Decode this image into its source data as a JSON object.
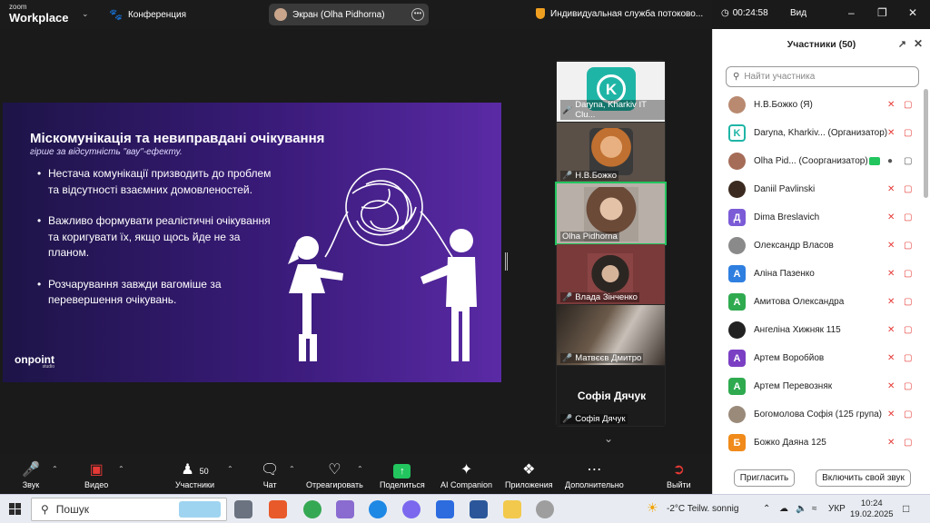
{
  "topbar": {
    "logo_small": "zoom",
    "logo_big": "Workplace",
    "conference_label": "Конференция",
    "screen_share_label": "Экран (Olha Pidhorna)",
    "recording_label": "Индивидуальная служба потоково...",
    "timer": "00:24:58",
    "view_label": "Вид"
  },
  "slide": {
    "title": "Міскомунікація та невиправдані очікування",
    "subtitle": "гірше за відсутність \"вау\"-ефекту.",
    "bullets": [
      "Нестача комунікації призводить до проблем та відсутності взаємних домовленостей.",
      "Важливо формувати реалістичні очікування та коригувати їх, якщо щось йде не за планом.",
      "Розчарування завжди вагоміше за перевершення очікувань."
    ],
    "brand": "onpoint",
    "brand_sub": "studio"
  },
  "tiles": [
    {
      "name": "Daryna, Kharkiv IT Clu...",
      "type": "logo",
      "active": false
    },
    {
      "name": "Н.В.Божко",
      "type": "video",
      "active": false
    },
    {
      "name": "Olha Pidhorna",
      "type": "video",
      "active": true
    },
    {
      "name": "Влада Зінченко",
      "type": "video",
      "active": false
    },
    {
      "name": "Матвєєв Дмитро",
      "type": "video",
      "active": false
    },
    {
      "name": "Софія Дячук",
      "type": "name-only",
      "active": false
    }
  ],
  "tile_big_name": "Софія Дячук",
  "panel": {
    "title": "Участники (50)",
    "search_placeholder": "Найти участника",
    "participants": [
      {
        "name": "Н.В.Божко (Я)",
        "avatar": "photo",
        "color": "#b98a70",
        "initial": ""
      },
      {
        "name": "Daryna, Kharkiv...  (Организатор)",
        "avatar": "logo",
        "color": "#1fb5a6",
        "initial": ""
      },
      {
        "name": "Olha Pid...   (Соорганизатор)",
        "avatar": "photo",
        "color": "#a56c58",
        "initial": ""
      },
      {
        "name": "Daniil Pavlinski",
        "avatar": "photo",
        "color": "#3b2a1f",
        "initial": ""
      },
      {
        "name": "Dima Breslavich",
        "avatar": "letter",
        "color": "#7b5bd6",
        "initial": "Д"
      },
      {
        "name": "Олександр Власов",
        "avatar": "photo",
        "color": "#8a8a8a",
        "initial": ""
      },
      {
        "name": "Аліна Пазенко",
        "avatar": "letter",
        "color": "#2f7fe0",
        "initial": "А"
      },
      {
        "name": "Амитова Олександра",
        "avatar": "letter",
        "color": "#2faa4f",
        "initial": "А"
      },
      {
        "name": "Ангеліна Хижняк 115",
        "avatar": "photo",
        "color": "#222222",
        "initial": ""
      },
      {
        "name": "Артем Воробйов",
        "avatar": "letter",
        "color": "#7b3fc4",
        "initial": "А"
      },
      {
        "name": "Артем Перевозняк",
        "avatar": "letter",
        "color": "#2faa4f",
        "initial": "А"
      },
      {
        "name": "Богомолова Софія (125 група)",
        "avatar": "photo",
        "color": "#9a8a7a",
        "initial": ""
      },
      {
        "name": "Божко Даяна 125",
        "avatar": "letter",
        "color": "#f08a1a",
        "initial": "Б"
      }
    ],
    "invite_label": "Пригласить",
    "unmute_label": "Включить свой звук"
  },
  "toolbar": {
    "audio": "Звук",
    "video": "Видео",
    "participants": "Участники",
    "participants_count": "50",
    "chat": "Чат",
    "react": "Отреагировать",
    "share": "Поделиться",
    "ai": "AI Companion",
    "apps": "Приложения",
    "more": "Дополнительно",
    "leave": "Выйти"
  },
  "taskbar": {
    "search_label": "Пошук",
    "weather": "-2°C  Teilw. sonnig",
    "lang": "УКР",
    "time": "10:24",
    "date": "19.02.2025"
  },
  "colors": {
    "accent_green": "#22c55e",
    "muted_red": "#e53935",
    "slide_purple": "#3a1b7a"
  }
}
